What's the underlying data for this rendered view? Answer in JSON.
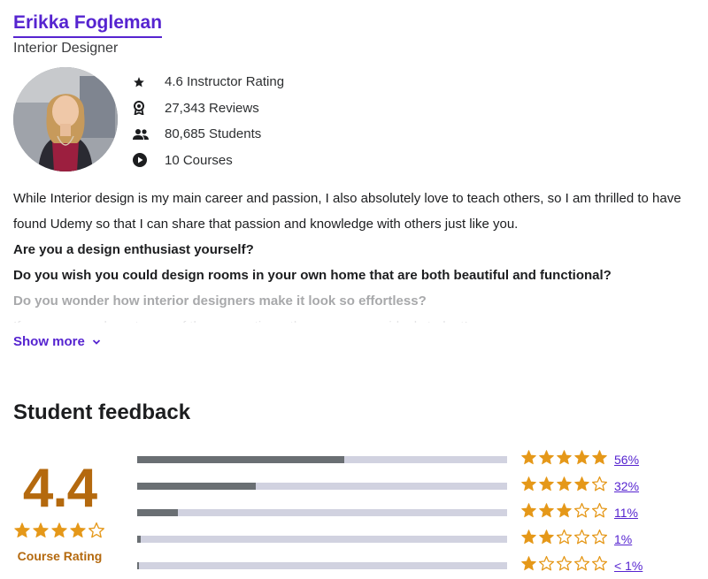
{
  "instructor": {
    "name": "Erikka Fogleman",
    "job_title": "Interior Designer",
    "stats": [
      {
        "icon": "star-icon",
        "text": "4.6 Instructor Rating"
      },
      {
        "icon": "award-icon",
        "text": "27,343 Reviews"
      },
      {
        "icon": "students-icon",
        "text": "80,685 Students"
      },
      {
        "icon": "play-circle-icon",
        "text": "10 Courses"
      }
    ],
    "bio": {
      "intro": "While Interior design is my main career and passion, I also absolutely love to teach others, so I am thrilled to have found Udemy so that I can share that passion and knowledge with others just like you.",
      "q1": "Are you a design enthusiast yourself?",
      "q2": "Do you wish you could design rooms in your own home that are both beautiful and functional?",
      "q3": "Do you wonder how interior designers make it look so effortless?",
      "q4": "If you answered yes to any of these questions, then you are my ideal student!"
    },
    "show_more": "Show more"
  },
  "feedback": {
    "title": "Student feedback",
    "rating": "4.4",
    "rating_value": 4.4,
    "rating_label": "Course Rating",
    "rows": [
      {
        "stars": 5,
        "percent": 56,
        "label": "56%"
      },
      {
        "stars": 4,
        "percent": 32,
        "label": "32%"
      },
      {
        "stars": 3,
        "percent": 11,
        "label": "11%"
      },
      {
        "stars": 2,
        "percent": 1,
        "label": "1%"
      },
      {
        "stars": 1,
        "percent": 0.5,
        "label": "< 1%"
      }
    ]
  },
  "colors": {
    "brand_purple": "#5624d0",
    "star_gold": "#e59819",
    "rating_brown": "#b4690e",
    "bar_track": "#d1d2e0",
    "bar_fill": "#6a6f73"
  }
}
